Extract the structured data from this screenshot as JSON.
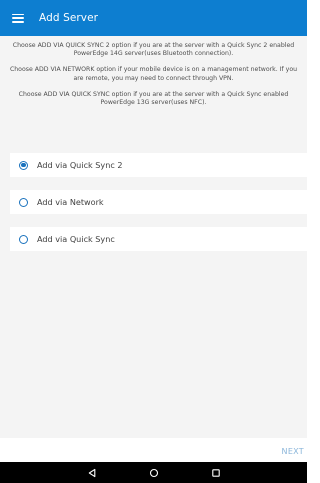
{
  "app_bar": {
    "title": "Add Server",
    "menu_icon": "menu-icon",
    "color": "#0d7ed0"
  },
  "instructions": [
    "Choose ADD VIA QUICK SYNC 2 option if you are at the server with a Quick Sync 2 enabled PowerEdge 14G server(uses Bluetooth connection).",
    "Choose ADD VIA NETWORK option if your mobile device is on a management network. If you are remote, you may need to connect through VPN.",
    "Choose ADD VIA QUICK SYNC option if you are at the server with a Quick Sync enabled PowerEdge 13G server(uses NFC)."
  ],
  "options": [
    {
      "label": "Add via Quick Sync 2",
      "selected": true
    },
    {
      "label": "Add via Network",
      "selected": false
    },
    {
      "label": "Add via Quick Sync",
      "selected": false
    }
  ],
  "footer": {
    "next_label": "NEXT"
  },
  "nav_bar": {
    "icons": [
      "back-icon",
      "home-icon",
      "recents-icon"
    ]
  }
}
